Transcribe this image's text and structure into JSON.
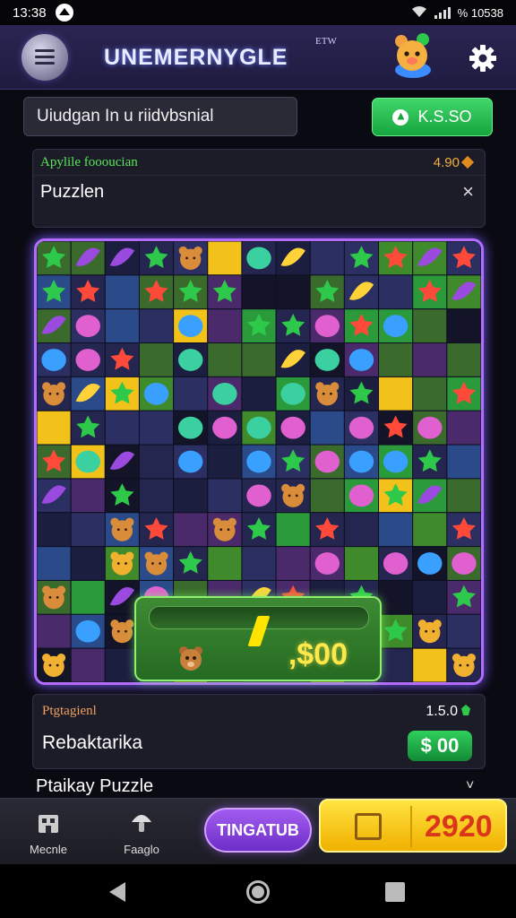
{
  "status_bar": {
    "time": "13:38",
    "right_text": "% 10538"
  },
  "header": {
    "title": "UNEMERNYGLE",
    "version": "ETW",
    "icons": {
      "menu": "hamburger-menu-icon",
      "mascot": "bear-mascot-icon",
      "settings": "gear-icon"
    }
  },
  "subtitle": {
    "text": "Uiudgan In u riidvbsnial"
  },
  "balance_button": {
    "label": "K.S.SO",
    "icon": "shield-icon",
    "color": "#1fb44a"
  },
  "info_card": {
    "label": "Apylile foooucian",
    "value": "4.90",
    "name": "Puzzlen",
    "close": "×"
  },
  "reward": {
    "amount": ",$00"
  },
  "progress_card": {
    "label": "Ptgtagienl",
    "value": "1.5.0",
    "name": "Rebaktarika",
    "price": "$ 00"
  },
  "footer": {
    "label": "Ptaikay Puzzle",
    "chevron": "˅"
  },
  "bottom_nav": {
    "left_label": "Mecnle",
    "middle_label": "Faaglo",
    "play_label": "TINGATUB",
    "coins": "2920"
  },
  "colors": {
    "accent_purple": "#b46cff",
    "accent_green": "#1fb44a",
    "coin_yellow": "#ffd21a",
    "coin_text": "#d9361a"
  }
}
